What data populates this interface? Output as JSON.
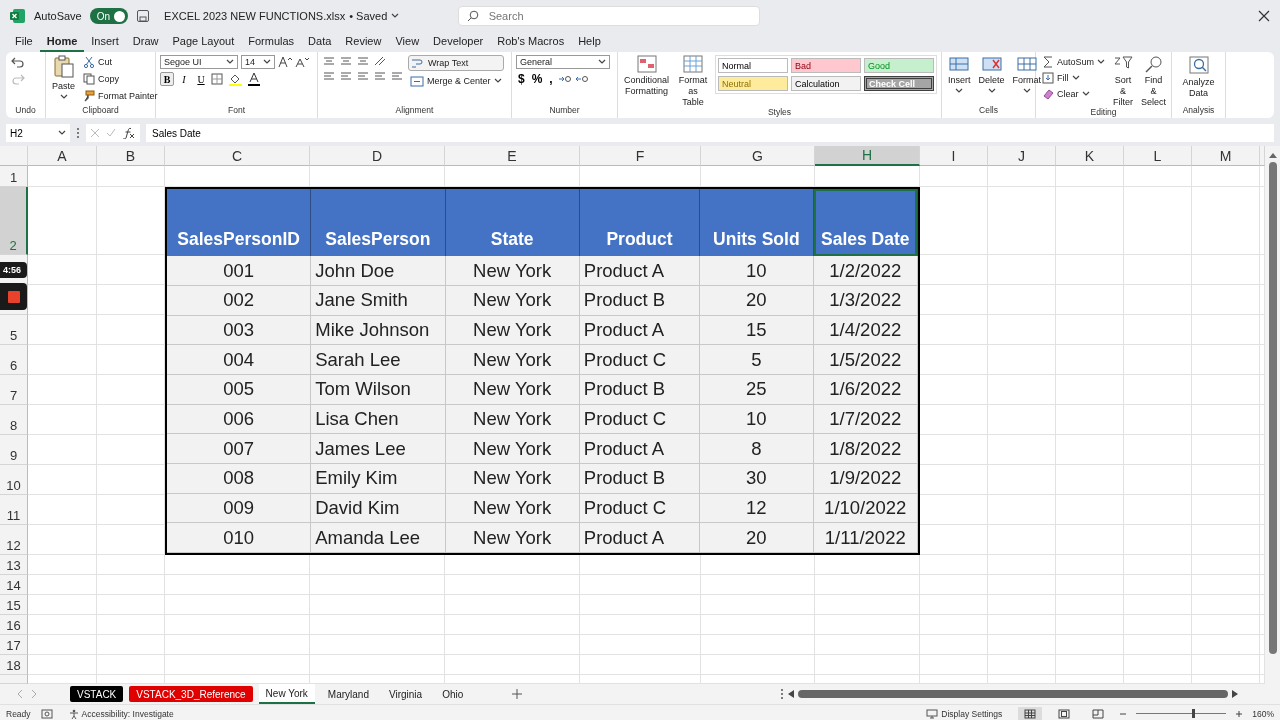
{
  "title_bar": {
    "autosave_label": "AutoSave",
    "autosave": {
      "on": true,
      "label": "On"
    },
    "filename": "EXCEL 2023 NEW FUNCTIONS.xlsx",
    "save_status": "• Saved",
    "search_placeholder": "Search"
  },
  "menu": [
    {
      "label": "File",
      "selected": false
    },
    {
      "label": "Home",
      "selected": true
    },
    {
      "label": "Insert",
      "selected": false
    },
    {
      "label": "Draw",
      "selected": false
    },
    {
      "label": "Page Layout",
      "selected": false
    },
    {
      "label": "Formulas",
      "selected": false
    },
    {
      "label": "Data",
      "selected": false
    },
    {
      "label": "Review",
      "selected": false
    },
    {
      "label": "View",
      "selected": false
    },
    {
      "label": "Developer",
      "selected": false
    },
    {
      "label": "Rob's Macros",
      "selected": false
    },
    {
      "label": "Help",
      "selected": false
    }
  ],
  "ribbon": {
    "groups": [
      {
        "kind": "undo",
        "label": "Undo"
      },
      {
        "kind": "clipboard",
        "label": "Clipboard",
        "paste": "Paste",
        "items": [
          "Cut",
          "Copy",
          "Format Painter"
        ]
      },
      {
        "kind": "font",
        "label": "Font",
        "font": "Segoe UI",
        "size": "14",
        "styles": [
          "B",
          "I",
          "U"
        ]
      },
      {
        "kind": "alignment",
        "label": "Alignment",
        "buttons": [
          "Wrap Text",
          "Merge & Center"
        ]
      },
      {
        "kind": "number",
        "label": "Number",
        "format": "General",
        "symbols": [
          "$",
          "%",
          ","
        ]
      },
      {
        "kind": "styles",
        "label": "Styles",
        "buttons": [
          "Conditional Formatting",
          "Format as Table"
        ],
        "cell_styles": [
          {
            "label": "Normal",
            "color": "#ffffff"
          },
          {
            "label": "Bad",
            "color": "#ffc7ce"
          },
          {
            "label": "Good",
            "color": "#c6efce"
          },
          {
            "label": "Neutral",
            "color": "#ffeb9c"
          },
          {
            "label": "Calculation",
            "color": "#f2f2f2"
          },
          {
            "label": "Check Cell",
            "color": "#a5a5a5"
          }
        ]
      },
      {
        "kind": "cells",
        "label": "Cells",
        "buttons": [
          "Insert",
          "Delete",
          "Format"
        ]
      },
      {
        "kind": "editing",
        "label": "Editing",
        "items": [
          "AutoSum",
          "Fill",
          "Clear"
        ],
        "buttons": [
          "Sort & Filter",
          "Find & Select"
        ]
      },
      {
        "kind": "analysis",
        "label": "Analysis",
        "buttons": [
          "Analyze Data"
        ]
      }
    ]
  },
  "formula_bar": {
    "name_box": "H2",
    "formula": "Sales Date"
  },
  "sheet": {
    "columns": [
      {
        "label": "A",
        "selected": false
      },
      {
        "label": "B",
        "selected": false
      },
      {
        "label": "C",
        "selected": false
      },
      {
        "label": "D",
        "selected": false
      },
      {
        "label": "E",
        "selected": false
      },
      {
        "label": "F",
        "selected": false
      },
      {
        "label": "G",
        "selected": false
      },
      {
        "label": "H",
        "selected": true
      },
      {
        "label": "I",
        "selected": false
      },
      {
        "label": "J",
        "selected": false
      },
      {
        "label": "K",
        "selected": false
      },
      {
        "label": "L",
        "selected": false
      },
      {
        "label": "M",
        "selected": false
      }
    ],
    "rows": [
      {
        "label": "1",
        "selected": false
      },
      {
        "label": "2",
        "selected": true
      },
      {
        "selected": false
      },
      {
        "selected": false
      },
      {
        "label": "5",
        "selected": false
      },
      {
        "label": "6",
        "selected": false
      },
      {
        "label": "7",
        "selected": false
      },
      {
        "label": "8",
        "selected": false
      },
      {
        "label": "9",
        "selected": false
      },
      {
        "label": "10",
        "selected": false
      },
      {
        "label": "11",
        "selected": false
      },
      {
        "label": "12",
        "selected": false
      },
      {
        "label": "13",
        "selected": false
      },
      {
        "label": "14",
        "selected": false
      },
      {
        "label": "15",
        "selected": false
      },
      {
        "label": "16",
        "selected": false
      },
      {
        "label": "17",
        "selected": false
      },
      {
        "label": "18",
        "selected": false
      }
    ],
    "table": {
      "columns": [
        {
          "label": "SalesPersonID",
          "selected": false
        },
        {
          "label": "SalesPerson",
          "selected": false
        },
        {
          "label": "State",
          "selected": false
        },
        {
          "label": "Product",
          "selected": false
        },
        {
          "label": "Units Sold",
          "selected": false
        },
        {
          "label": "Sales Date",
          "selected": true
        }
      ],
      "rows": [
        [
          "001",
          "John Doe",
          "New York",
          "Product A",
          "10",
          "1/2/2022"
        ],
        [
          "002",
          "Jane Smith",
          "New York",
          "Product B",
          "20",
          "1/3/2022"
        ],
        [
          "003",
          "Mike Johnson",
          "New York",
          "Product A",
          "15",
          "1/4/2022"
        ],
        [
          "004",
          "Sarah Lee",
          "New York",
          "Product C",
          "5",
          "1/5/2022"
        ],
        [
          "005",
          "Tom Wilson",
          "New York",
          "Product B",
          "25",
          "1/6/2022"
        ],
        [
          "006",
          "Lisa Chen",
          "New York",
          "Product C",
          "10",
          "1/7/2022"
        ],
        [
          "007",
          "James Lee",
          "New York",
          "Product A",
          "8",
          "1/8/2022"
        ],
        [
          "008",
          "Emily Kim",
          "New York",
          "Product B",
          "30",
          "1/9/2022"
        ],
        [
          "009",
          "David Kim",
          "New York",
          "Product C",
          "12",
          "1/10/2022"
        ],
        [
          "010",
          "Amanda Lee",
          "New York",
          "Product A",
          "20",
          "1/11/2022"
        ]
      ]
    }
  },
  "recorder": {
    "time": "4:56"
  },
  "sheet_tabs": [
    {
      "label": "VSTACK",
      "selected": false,
      "color": "#000000"
    },
    {
      "label": "VSTACK_3D_Reference",
      "selected": false,
      "color": "#e00000"
    },
    {
      "label": "New York",
      "selected": true
    },
    {
      "label": "Maryland",
      "selected": false
    },
    {
      "label": "Virginia",
      "selected": false
    },
    {
      "label": "Ohio",
      "selected": false
    }
  ],
  "status_bar": {
    "mode": "Ready",
    "accessibility": "Accessibility: Investigate",
    "display_settings": "Display Settings",
    "zoom": {
      "level": 0.62,
      "label": "160%"
    }
  }
}
